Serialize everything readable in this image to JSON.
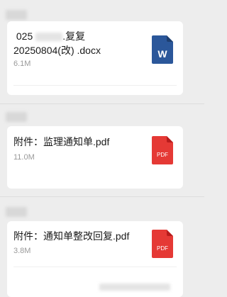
{
  "messages": [
    {
      "file_name": " 025　　　.复复\n20250804(改) .docx",
      "file_size": "6.1M",
      "file_type": "W",
      "icon": "word-doc-icon",
      "icon_color": "#2b579a"
    },
    {
      "file_name": "附件：监理通知单.pdf",
      "file_size": "11.0M",
      "file_type": "PDF",
      "icon": "pdf-icon",
      "icon_color": "#e53935"
    },
    {
      "file_name": "附件：通知单整改回复.pdf",
      "file_size": "3.8M",
      "file_type": "PDF",
      "icon": "pdf-icon",
      "icon_color": "#e53935"
    }
  ],
  "colors": {
    "background": "#ededed",
    "card": "#ffffff",
    "secondary_text": "#9a9a9a"
  }
}
